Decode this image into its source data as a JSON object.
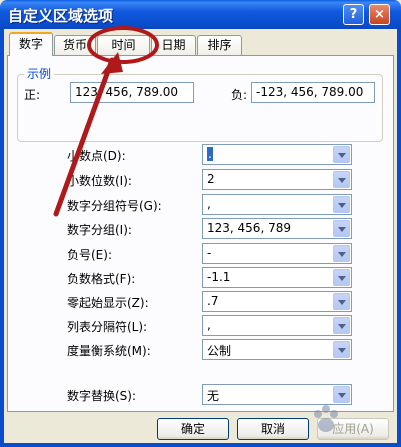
{
  "window": {
    "title": "自定义区域选项",
    "help_label": "?",
    "close_label": "×"
  },
  "tabs": [
    {
      "label": "数字",
      "active": true
    },
    {
      "label": "货币",
      "active": false
    },
    {
      "label": "时间",
      "active": false
    },
    {
      "label": "日期",
      "active": false
    },
    {
      "label": "排序",
      "active": false
    }
  ],
  "example": {
    "legend": "示例",
    "positive_label": "正:",
    "positive_value": "123, 456, 789.00",
    "negative_label": "负:",
    "negative_value": "-123, 456, 789.00"
  },
  "settings": [
    {
      "label": "小数点(D):",
      "value": "."
    },
    {
      "label": "小数位数(I):",
      "value": "2"
    },
    {
      "label": "数字分组符号(G):",
      "value": ","
    },
    {
      "label": "数字分组(I):",
      "value": "123, 456, 789"
    },
    {
      "label": "负号(E):",
      "value": "-"
    },
    {
      "label": "负数格式(F):",
      "value": "-1.1"
    },
    {
      "label": "零起始显示(Z):",
      "value": ".7"
    },
    {
      "label": "列表分隔符(L):",
      "value": ","
    },
    {
      "label": "度量衡系统(M):",
      "value": "公制"
    },
    {
      "label": "数字替换(S):",
      "value": "无"
    }
  ],
  "buttons": {
    "ok": "确定",
    "cancel": "取消",
    "apply": "应用(A)"
  },
  "annotation_color": "#b01919"
}
